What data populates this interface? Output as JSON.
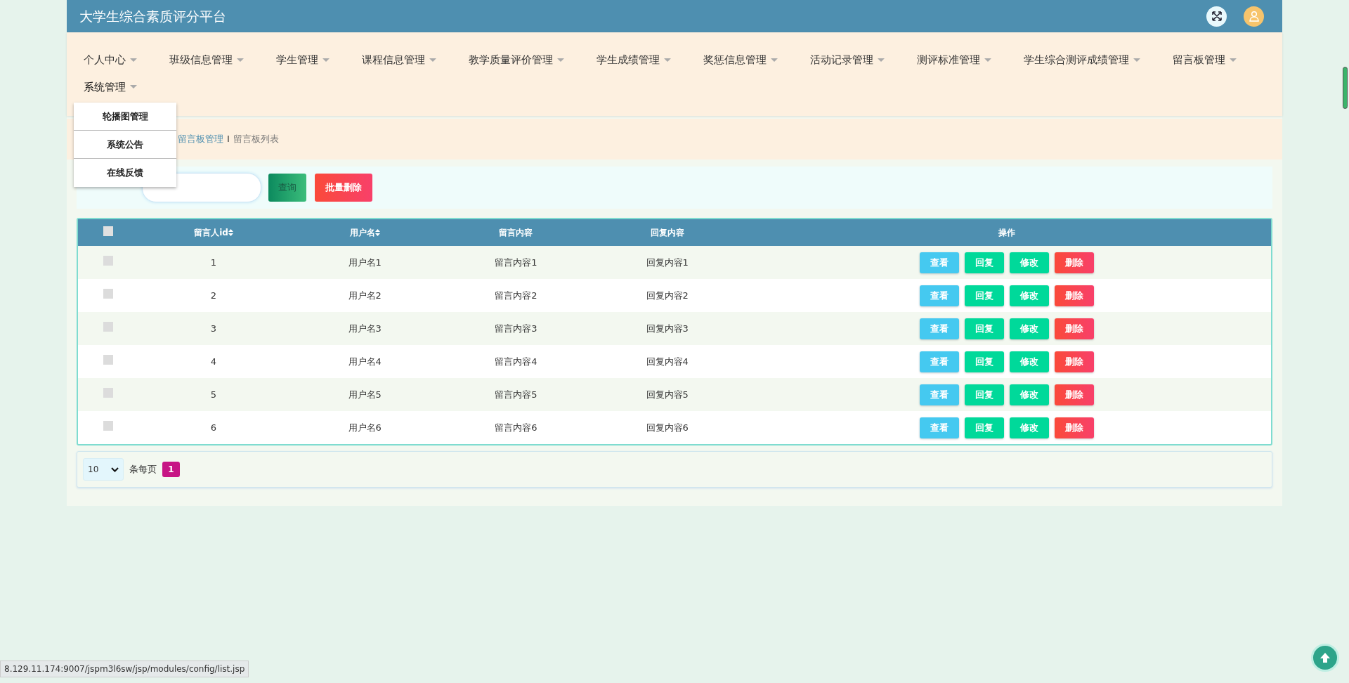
{
  "header": {
    "title": "大学生综合素质评分平台"
  },
  "nav": [
    {
      "label": "个人中心",
      "expanded": false
    },
    {
      "label": "班级信息管理",
      "expanded": false
    },
    {
      "label": "学生管理",
      "expanded": false
    },
    {
      "label": "课程信息管理",
      "expanded": false
    },
    {
      "label": "教学质量评价管理",
      "expanded": false
    },
    {
      "label": "学生成绩管理",
      "expanded": false
    },
    {
      "label": "奖惩信息管理",
      "expanded": false
    },
    {
      "label": "活动记录管理",
      "expanded": false
    },
    {
      "label": "测评标准管理",
      "expanded": false
    },
    {
      "label": "学生综合测评成绩管理",
      "expanded": false
    },
    {
      "label": "留言板管理",
      "expanded": false
    },
    {
      "label": "系统管理",
      "expanded": true,
      "menu": [
        "轮播图管理",
        "系统公告",
        "在线反馈"
      ]
    }
  ],
  "breadcrumb": {
    "items": [
      "留言板管理",
      "留言板列表"
    ],
    "separator": "I"
  },
  "search": {
    "query_button": "查询",
    "bulk_delete_button": "批量删除"
  },
  "table": {
    "select_all": {
      "checked": false
    },
    "columns": [
      {
        "kind": "text",
        "label": "留言人id",
        "sortable": true
      },
      {
        "kind": "text",
        "label": "用户名",
        "sortable": true
      },
      {
        "kind": "text",
        "label": "留言内容",
        "sortable": false
      },
      {
        "kind": "text",
        "label": "回复内容",
        "sortable": false
      },
      {
        "kind": "actions",
        "label": "操作",
        "sortable": false
      }
    ],
    "rows": [
      {
        "checked": false,
        "cells": [
          "1",
          "用户名1",
          "留言内容1",
          "回复内容1"
        ],
        "actions": [
          {
            "kind": "view",
            "label": "查看"
          },
          {
            "kind": "reply",
            "label": "回复"
          },
          {
            "kind": "edit",
            "label": "修改"
          },
          {
            "kind": "delete",
            "label": "删除"
          }
        ]
      },
      {
        "checked": false,
        "cells": [
          "2",
          "用户名2",
          "留言内容2",
          "回复内容2"
        ],
        "actions": [
          {
            "kind": "view",
            "label": "查看"
          },
          {
            "kind": "reply",
            "label": "回复"
          },
          {
            "kind": "edit",
            "label": "修改"
          },
          {
            "kind": "delete",
            "label": "删除"
          }
        ]
      },
      {
        "checked": false,
        "cells": [
          "3",
          "用户名3",
          "留言内容3",
          "回复内容3"
        ],
        "actions": [
          {
            "kind": "view",
            "label": "查看"
          },
          {
            "kind": "reply",
            "label": "回复"
          },
          {
            "kind": "edit",
            "label": "修改"
          },
          {
            "kind": "delete",
            "label": "删除"
          }
        ]
      },
      {
        "checked": false,
        "cells": [
          "4",
          "用户名4",
          "留言内容4",
          "回复内容4"
        ],
        "actions": [
          {
            "kind": "view",
            "label": "查看"
          },
          {
            "kind": "reply",
            "label": "回复"
          },
          {
            "kind": "edit",
            "label": "修改"
          },
          {
            "kind": "delete",
            "label": "删除"
          }
        ]
      },
      {
        "checked": false,
        "cells": [
          "5",
          "用户名5",
          "留言内容5",
          "回复内容5"
        ],
        "actions": [
          {
            "kind": "view",
            "label": "查看"
          },
          {
            "kind": "reply",
            "label": "回复"
          },
          {
            "kind": "edit",
            "label": "修改"
          },
          {
            "kind": "delete",
            "label": "删除"
          }
        ]
      },
      {
        "checked": false,
        "cells": [
          "6",
          "用户名6",
          "留言内容6",
          "回复内容6"
        ],
        "actions": [
          {
            "kind": "view",
            "label": "查看"
          },
          {
            "kind": "reply",
            "label": "回复"
          },
          {
            "kind": "edit",
            "label": "修改"
          },
          {
            "kind": "delete",
            "label": "删除"
          }
        ]
      }
    ]
  },
  "pagination": {
    "page_size": "10",
    "per_page_label": "条每页",
    "pages": [
      {
        "label": "1",
        "selected": true
      }
    ]
  },
  "status_bar": {
    "url": "8.129.11.174:9007/jspm3l6sw/jsp/modules/config/list.jsp"
  }
}
